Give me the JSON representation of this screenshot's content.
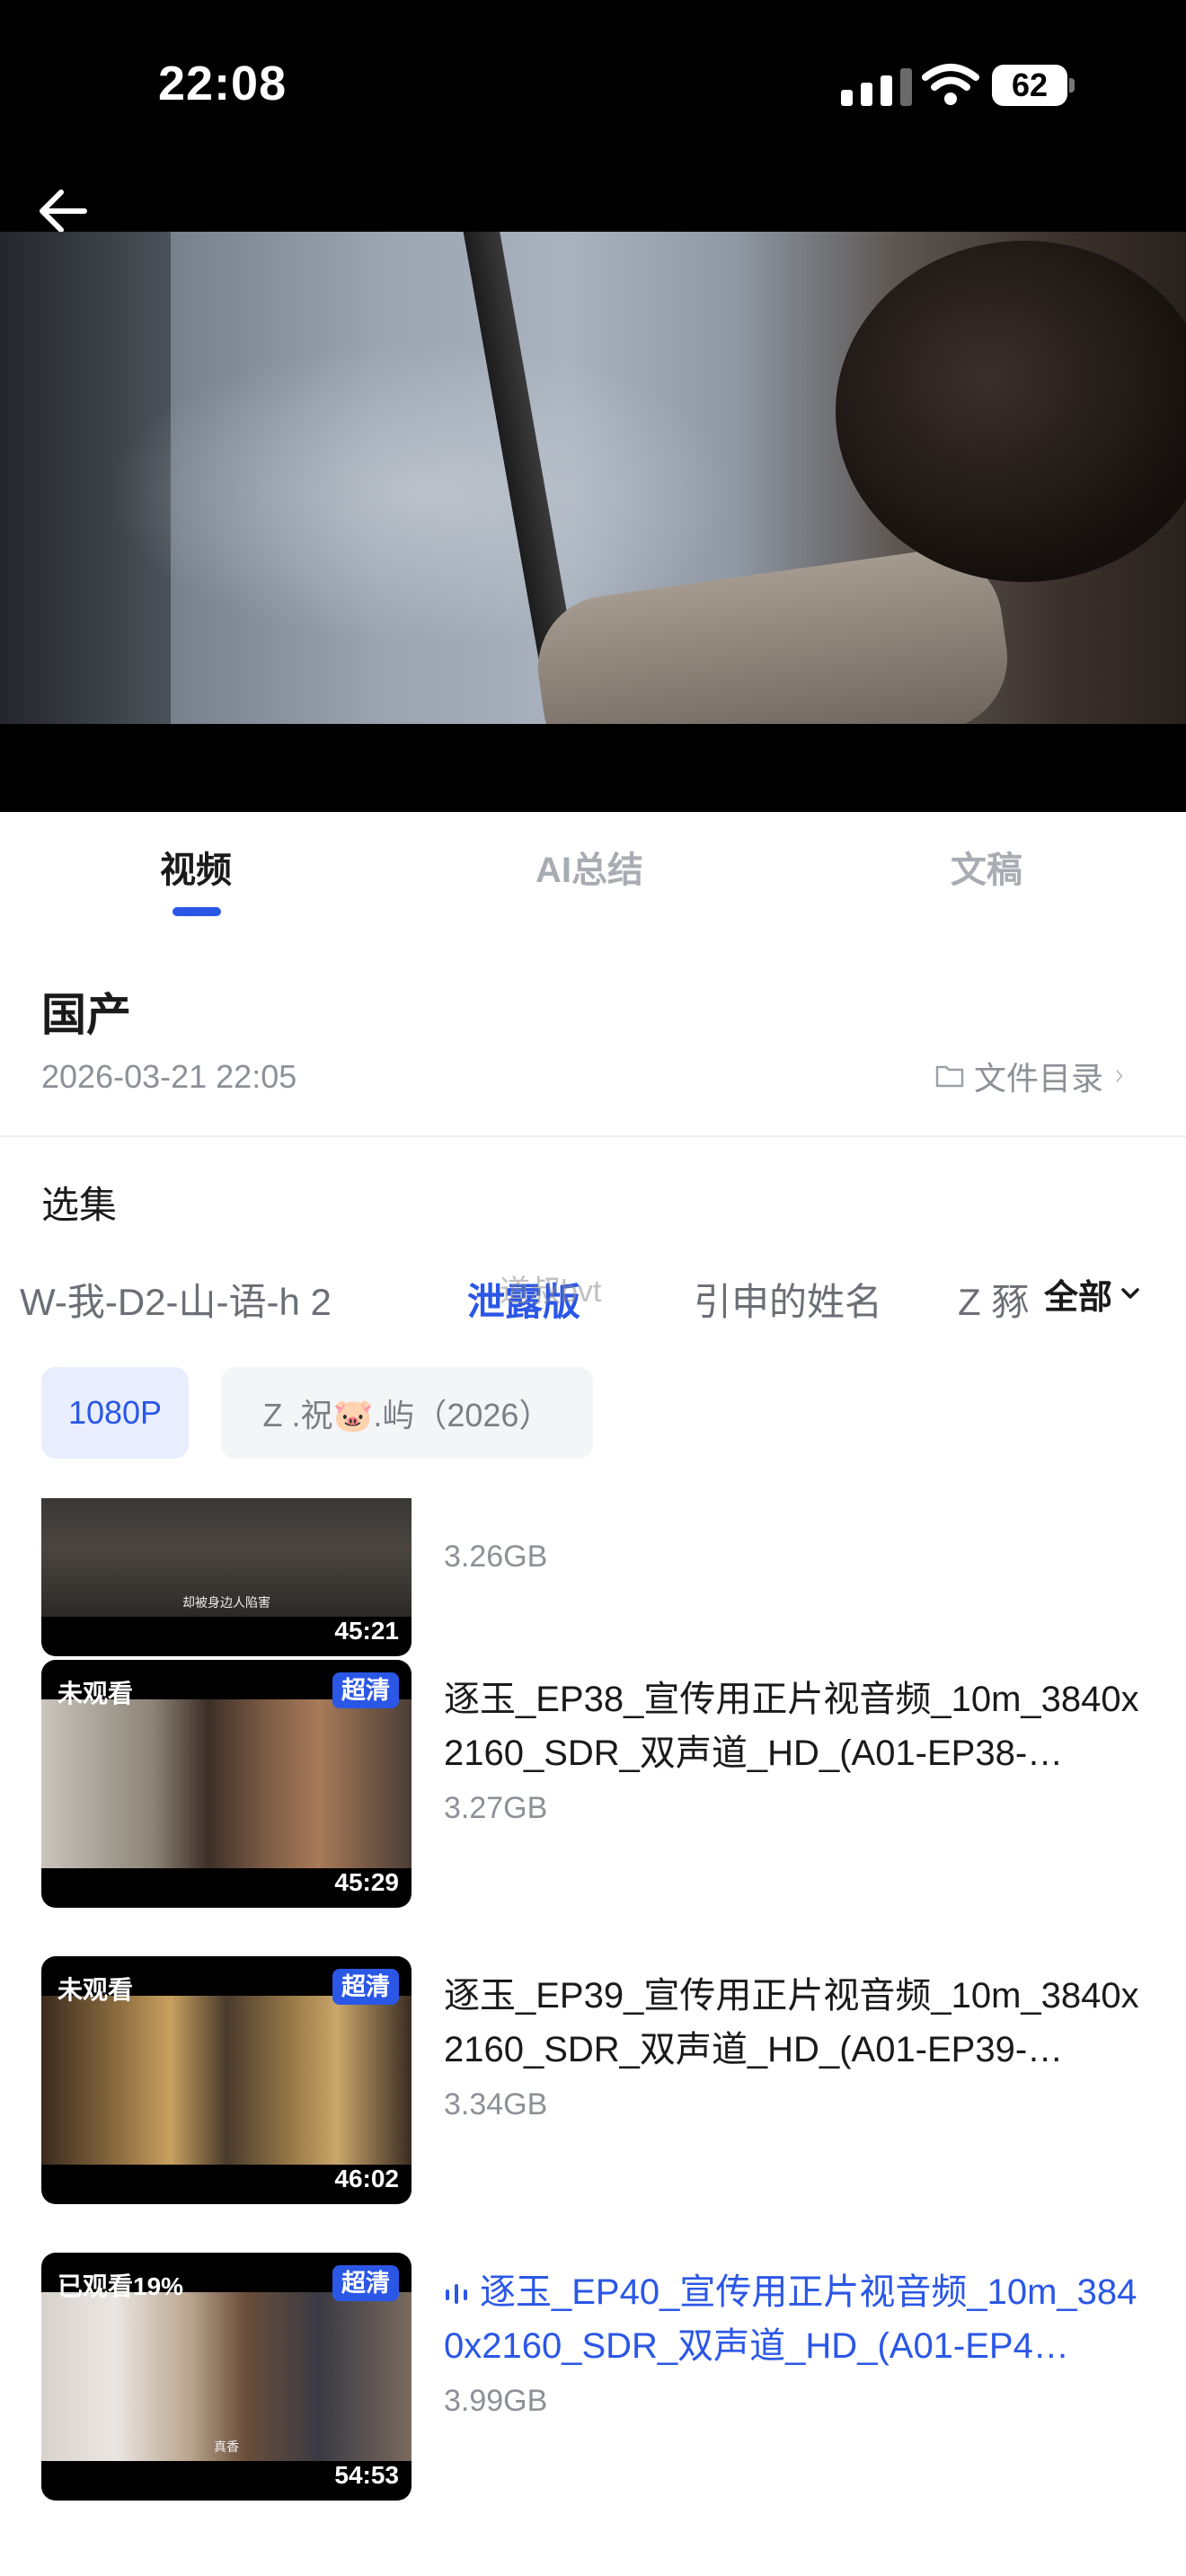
{
  "status_bar": {
    "time": "22:08",
    "battery": "62"
  },
  "tabs": [
    {
      "label": "视频",
      "active": true
    },
    {
      "label": "AI总结",
      "active": false
    },
    {
      "label": "文稿",
      "active": false
    }
  ],
  "info": {
    "title": "国产",
    "date": "2026-03-21 22:05",
    "file_dir_label": "文件目录"
  },
  "selection": {
    "label": "选集",
    "episode_tabs": [
      {
        "label": "W-我-D2-山-语-h 2",
        "active": false
      },
      {
        "label": "泄露版",
        "active": true
      },
      {
        "label": "引申的姓名",
        "active": false
      },
      {
        "label": "Z 豩",
        "active": false
      }
    ],
    "watermark": "道叔bvt",
    "all_label": "全部"
  },
  "chips": {
    "resolution": "1080P",
    "source": "Z  .祝🐷.屿（2026）"
  },
  "episodes": [
    {
      "title": "",
      "size": "3.26GB",
      "watch": "",
      "hd": "",
      "duration": "45:21",
      "subtitle": "却被身边人陷害",
      "playing": false
    },
    {
      "title": "逐玉_EP38_宣传用正片视音频_10m_3840x2160_SDR_双声道_HD_(A01-EP38-…",
      "size": "3.27GB",
      "watch": "未观看",
      "hd": "超清",
      "duration": "45:29",
      "subtitle": "",
      "playing": false
    },
    {
      "title": "逐玉_EP39_宣传用正片视音频_10m_3840x2160_SDR_双声道_HD_(A01-EP39-…",
      "size": "3.34GB",
      "watch": "未观看",
      "hd": "超清",
      "duration": "46:02",
      "subtitle": "",
      "playing": false
    },
    {
      "title": "逐玉_EP40_宣传用正片视音频_10m_3840x2160_SDR_双声道_HD_(A01-EP4…",
      "size": "3.99GB",
      "watch": "已观看19%",
      "hd": "超清",
      "duration": "54:53",
      "subtitle": "真香",
      "playing": true
    }
  ],
  "colors": {
    "accent": "#2b57e6",
    "muted": "#8d9197"
  }
}
